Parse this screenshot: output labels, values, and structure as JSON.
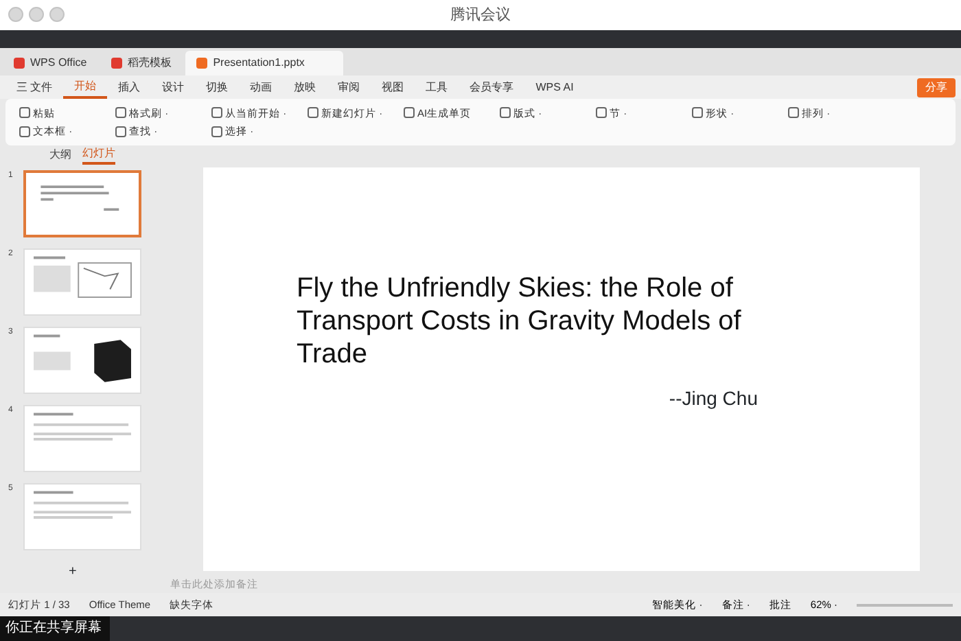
{
  "meeting": {
    "title": "腾讯会议",
    "share_label": "你正在共享屏幕"
  },
  "doc_tabs": [
    {
      "label": "WPS Office",
      "kind": "home",
      "selected": false
    },
    {
      "label": "稻壳模板",
      "kind": "template",
      "selected": false
    },
    {
      "label": "Presentation1.pptx",
      "kind": "doc",
      "selected": true
    }
  ],
  "file_menu": "三 文件",
  "menu": [
    {
      "label": "开始",
      "selected": true
    },
    {
      "label": "插入",
      "selected": false
    },
    {
      "label": "设计",
      "selected": false
    },
    {
      "label": "切换",
      "selected": false
    },
    {
      "label": "动画",
      "selected": false
    },
    {
      "label": "放映",
      "selected": false
    },
    {
      "label": "审阅",
      "selected": false
    },
    {
      "label": "视图",
      "selected": false
    },
    {
      "label": "工具",
      "selected": false
    },
    {
      "label": "会员专享",
      "selected": false
    },
    {
      "label": "WPS AI",
      "selected": false
    }
  ],
  "share_button": "分享",
  "ribbon": [
    {
      "label": "粘贴"
    },
    {
      "label": "格式刷 ·"
    },
    {
      "label": "从当前开始 ·"
    },
    {
      "label": "新建幻灯片 ·"
    },
    {
      "label": "AI生成单页"
    },
    {
      "label": "版式 ·"
    },
    {
      "label": "节 ·"
    },
    {
      "label": "形状 ·"
    },
    {
      "label": "排列 ·"
    },
    {
      "label": "文本框 ·"
    },
    {
      "label": "查找 ·"
    },
    {
      "label": "选择 ·"
    }
  ],
  "panel_tabs": [
    {
      "label": "大纲",
      "selected": false
    },
    {
      "label": "幻灯片",
      "selected": true
    }
  ],
  "slides": [
    {
      "number": "1",
      "selected": true,
      "kind": "title"
    },
    {
      "number": "2",
      "selected": false,
      "kind": "figure"
    },
    {
      "number": "3",
      "selected": false,
      "kind": "cube"
    },
    {
      "number": "4",
      "selected": false,
      "kind": "text"
    },
    {
      "number": "5",
      "selected": false,
      "kind": "text"
    }
  ],
  "add_slide": "+",
  "slide": {
    "title": "Fly the Unfriendly Skies: the Role of Transport Costs in Gravity Models of Trade",
    "author": "--Jing Chu"
  },
  "notes_placeholder": "单击此处添加备注",
  "status_bar": {
    "slide_count": "幻灯片 1 / 33",
    "theme": "Office Theme",
    "font": "缺失字体",
    "beautify": "智能美化 ·",
    "notes": "备注 ·",
    "comments": "批注",
    "zoom": "62% ·"
  }
}
